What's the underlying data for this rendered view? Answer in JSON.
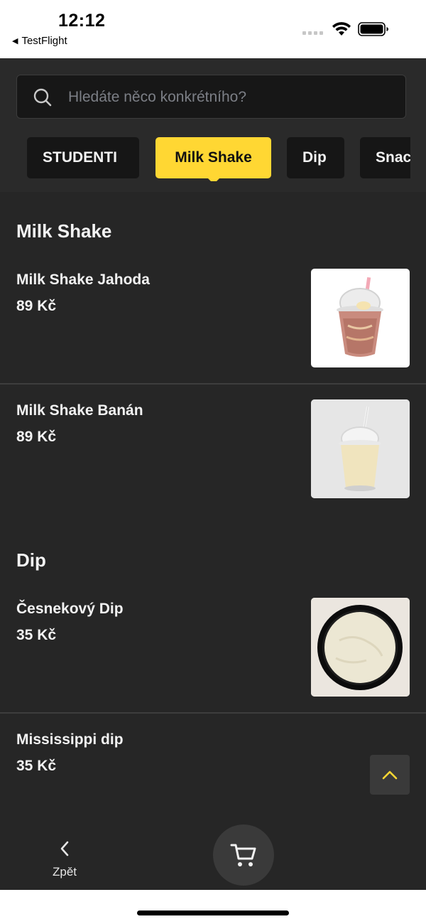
{
  "status_bar": {
    "time": "12:12",
    "back_app": "TestFlight"
  },
  "search": {
    "placeholder": "Hledáte něco konkrétního?",
    "icon": "search-icon"
  },
  "categories": [
    {
      "label": "STUDENTI",
      "active": false
    },
    {
      "label": "Milk Shake",
      "active": true
    },
    {
      "label": "Dip",
      "active": false
    },
    {
      "label": "Snack",
      "active": false
    }
  ],
  "sections": [
    {
      "title": "Milk Shake",
      "items": [
        {
          "name": "Milk Shake Jahoda",
          "price": "89 Kč"
        },
        {
          "name": "Milk Shake Banán",
          "price": "89 Kč"
        }
      ]
    },
    {
      "title": "Dip",
      "items": [
        {
          "name": "Česnekový Dip",
          "price": "35 Kč"
        },
        {
          "name": "Mississippi dip",
          "price": "35 Kč"
        }
      ]
    }
  ],
  "bottom_bar": {
    "back_label": "Zpět",
    "cart_icon": "cart-icon"
  },
  "colors": {
    "accent": "#ffd733",
    "background": "#262626",
    "chip": "#161616"
  }
}
